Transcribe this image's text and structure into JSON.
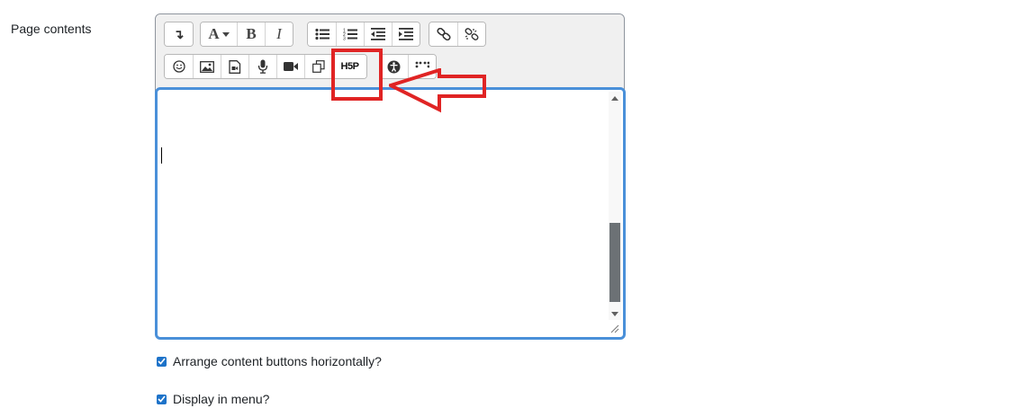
{
  "field": {
    "label": "Page contents"
  },
  "toolbar": {
    "row1": [
      {
        "name": "show-more-buttons-icon",
        "glyph": "↴"
      },
      {
        "name": "font-size-icon",
        "glyph": "A"
      },
      {
        "name": "bold-icon",
        "glyph": "B"
      },
      {
        "name": "italic-icon",
        "glyph": "I"
      },
      {
        "name": "unordered-list-icon"
      },
      {
        "name": "ordered-list-icon"
      },
      {
        "name": "outdent-icon"
      },
      {
        "name": "indent-icon"
      },
      {
        "name": "link-icon"
      },
      {
        "name": "unlink-icon"
      }
    ],
    "row2": [
      {
        "name": "emoji-icon"
      },
      {
        "name": "image-icon"
      },
      {
        "name": "media-icon"
      },
      {
        "name": "record-audio-icon"
      },
      {
        "name": "record-video-icon"
      },
      {
        "name": "manage-files-icon"
      },
      {
        "name": "h5p-icon",
        "label": "H5P"
      },
      {
        "name": "accessibility-checker-icon"
      },
      {
        "name": "screenreader-helper-icon"
      }
    ]
  },
  "editor": {
    "content": ""
  },
  "annotation": {
    "color": "#e02424"
  },
  "options": [
    {
      "label": "Arrange content buttons horizontally?",
      "checked": true
    },
    {
      "label": "Display in menu?",
      "checked": true
    }
  ],
  "colors": {
    "focus_border": "#4a90d9",
    "checkbox": "#1e73c9",
    "toolbar_bg": "#f0f0f0"
  }
}
